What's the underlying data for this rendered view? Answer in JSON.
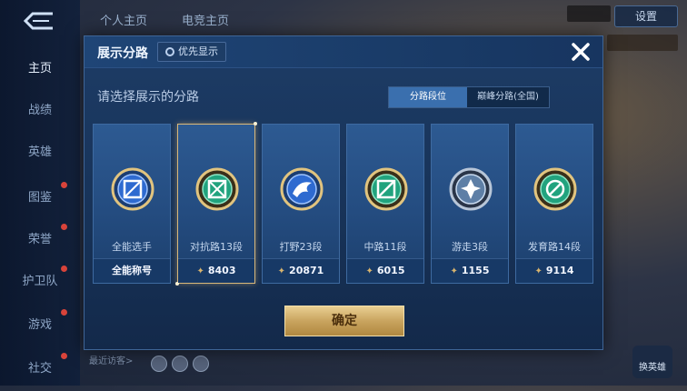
{
  "sidebar": {
    "items": [
      {
        "label": "主页",
        "active": true,
        "badge": false
      },
      {
        "label": "战绩",
        "active": false,
        "badge": false
      },
      {
        "label": "英雄",
        "active": false,
        "badge": false
      },
      {
        "label": "图鉴",
        "active": false,
        "badge": true
      },
      {
        "label": "荣誉",
        "active": false,
        "badge": true
      },
      {
        "label": "护卫队",
        "active": false,
        "badge": true
      },
      {
        "label": "游戏",
        "active": false,
        "badge": true
      },
      {
        "label": "社交",
        "active": false,
        "badge": true
      }
    ]
  },
  "background": {
    "top_tabs": [
      "个人主页",
      "电竞主页"
    ],
    "settings_label": "设置",
    "recent_visitors_label": "最近访客>",
    "bottom_right_label": "换英雄"
  },
  "modal": {
    "title": "展示分路",
    "priority_label": "优先显示",
    "subtitle": "请选择展示的分路",
    "segments": [
      {
        "label": "分路段位",
        "selected": true
      },
      {
        "label": "巅峰分路(全国)",
        "selected": false
      }
    ],
    "cards": [
      {
        "lane": "全能选手",
        "footer": "全能称号",
        "show_wing": false,
        "selected": false,
        "icon": "all-round-emblem-icon"
      },
      {
        "lane": "对抗路13段",
        "footer": "8403",
        "show_wing": true,
        "selected": true,
        "icon": "clash-lane-emblem-icon"
      },
      {
        "lane": "打野23段",
        "footer": "20871",
        "show_wing": true,
        "selected": false,
        "icon": "jungle-emblem-icon"
      },
      {
        "lane": "中路11段",
        "footer": "6015",
        "show_wing": true,
        "selected": false,
        "icon": "mid-lane-emblem-icon"
      },
      {
        "lane": "游走3段",
        "footer": "1155",
        "show_wing": true,
        "selected": false,
        "icon": "roam-emblem-icon"
      },
      {
        "lane": "发育路14段",
        "footer": "9114",
        "show_wing": true,
        "selected": false,
        "icon": "farm-lane-emblem-icon"
      }
    ],
    "confirm_label": "确定"
  },
  "colors": {
    "modal_bg": "#1d3c66",
    "card_bg": "#2d5a92",
    "selected_border": "#d9b87a",
    "confirm_gold": "#c9a45f"
  }
}
